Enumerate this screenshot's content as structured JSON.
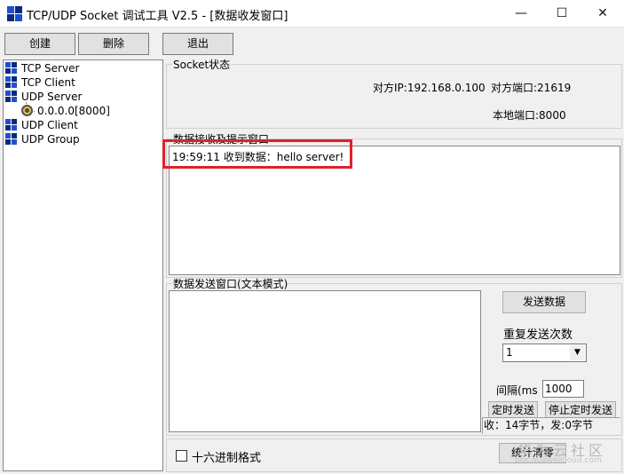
{
  "window": {
    "title": "TCP/UDP Socket 调试工具 V2.5 - [数据收发窗口]",
    "minimize_glyph": "—",
    "maximize_glyph": "☐",
    "close_glyph": "✕"
  },
  "toolbar": {
    "create_label": "创建",
    "delete_label": "删除",
    "exit_label": "退出"
  },
  "tree": {
    "tcp_server": "TCP Server",
    "tcp_client": "TCP Client",
    "udp_server": "UDP Server",
    "udp_server_child": "0.0.0.0[8000]",
    "udp_client": "UDP Client",
    "udp_group": "UDP Group"
  },
  "socket_status": {
    "title": "Socket状态",
    "remote_ip": "对方IP:192.168.0.100",
    "remote_port": "对方端口:21619",
    "local_port": "本地端口:8000"
  },
  "receive": {
    "title": "数据接收及提示窗口",
    "lines": [
      "19:59:11 收到数据：hello server!"
    ]
  },
  "send": {
    "title": "数据发送窗口(文本模式)",
    "send_button": "发送数据",
    "repeat_label": "重复发送次数",
    "repeat_value": "1",
    "interval_label": "间隔(ms",
    "interval_value": "1000",
    "timed_send_button": "定时发送",
    "stop_timed_button": "停止定时发送",
    "status_text": "收：14字节，发:0字节"
  },
  "bottom": {
    "hex_label": "十六进制格式",
    "stats_clear_button": "统计清零"
  },
  "watermark": {
    "brand": "华为云社区",
    "url": "bbs.huaweicloud.com"
  },
  "colors": {
    "highlight_border": "#e0202a",
    "icon_blue": "#1f4fd0",
    "icon_navy": "#0b2a7a"
  }
}
